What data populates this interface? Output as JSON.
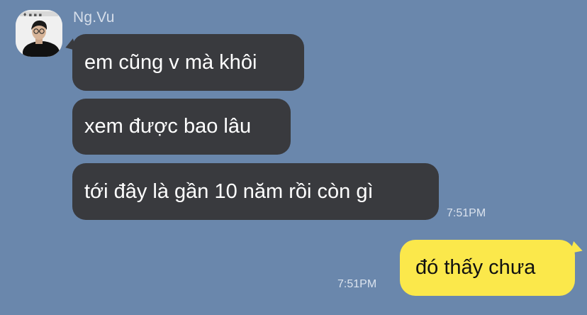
{
  "conversation": {
    "incoming": {
      "sender_name": "Ng.Vu",
      "messages": [
        {
          "text": "em cũng v mà khôi"
        },
        {
          "text": "xem được bao lâu"
        },
        {
          "text": "tới đây là gần 10 năm rồi còn gì"
        }
      ],
      "time": "7:51PM"
    },
    "outgoing": {
      "messages": [
        {
          "text": "đó thấy chưa"
        }
      ],
      "time": "7:51PM"
    }
  },
  "colors": {
    "background": "#6a87ac",
    "incoming_bubble": "#393a3e",
    "outgoing_bubble": "#fbe84b"
  },
  "icons": {
    "avatar": "profile-photo-avatar"
  }
}
